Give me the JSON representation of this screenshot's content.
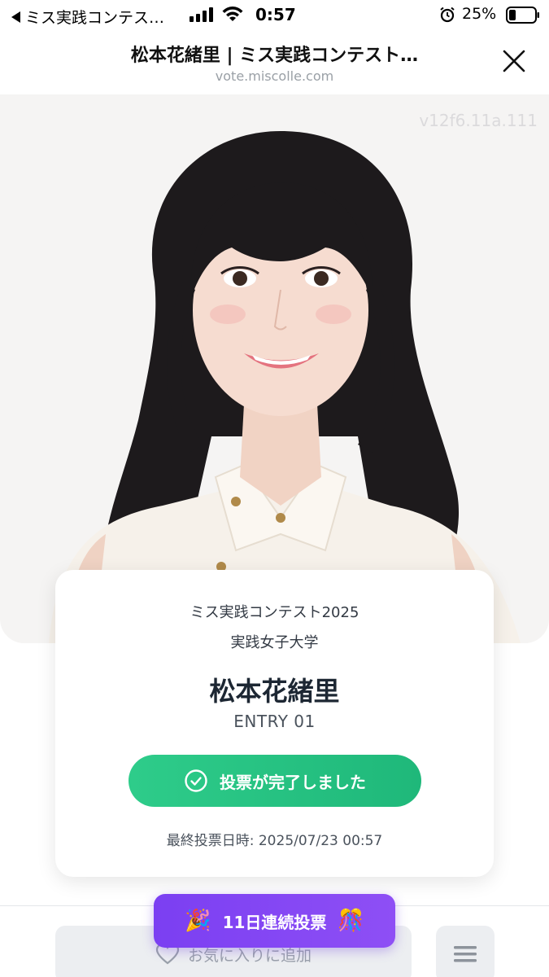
{
  "status_bar": {
    "back_label": "ミス実践コンテス…",
    "time": "0:57",
    "battery": "25%"
  },
  "header": {
    "title": "松本花緒里 | ミス実践コンテスト…",
    "url": "vote.miscolle.com"
  },
  "photo": {
    "watermark": "v12f6.11a.111"
  },
  "card": {
    "contest": "ミス実践コンテスト2025",
    "university": "実践女子大学",
    "name": "松本花緒里",
    "entry": "ENTRY 01",
    "vote_status": "投票が完了しました",
    "last_vote": "最終投票日時: 2025/07/23 00:57"
  },
  "streak": {
    "label": "11日連続投票",
    "left_emoji": "🎉",
    "right_emoji": "🎊"
  },
  "bottom": {
    "favorite_label": "お気に入りに追加"
  },
  "colors": {
    "vote_green": "#22c17f",
    "streak_purple": "#8447f4"
  },
  "icons": [
    "back-arrow-icon",
    "signal-icon",
    "wifi-icon",
    "alarm-icon",
    "battery-icon",
    "close-icon",
    "check-circle-icon",
    "heart-icon",
    "menu-icon"
  ]
}
